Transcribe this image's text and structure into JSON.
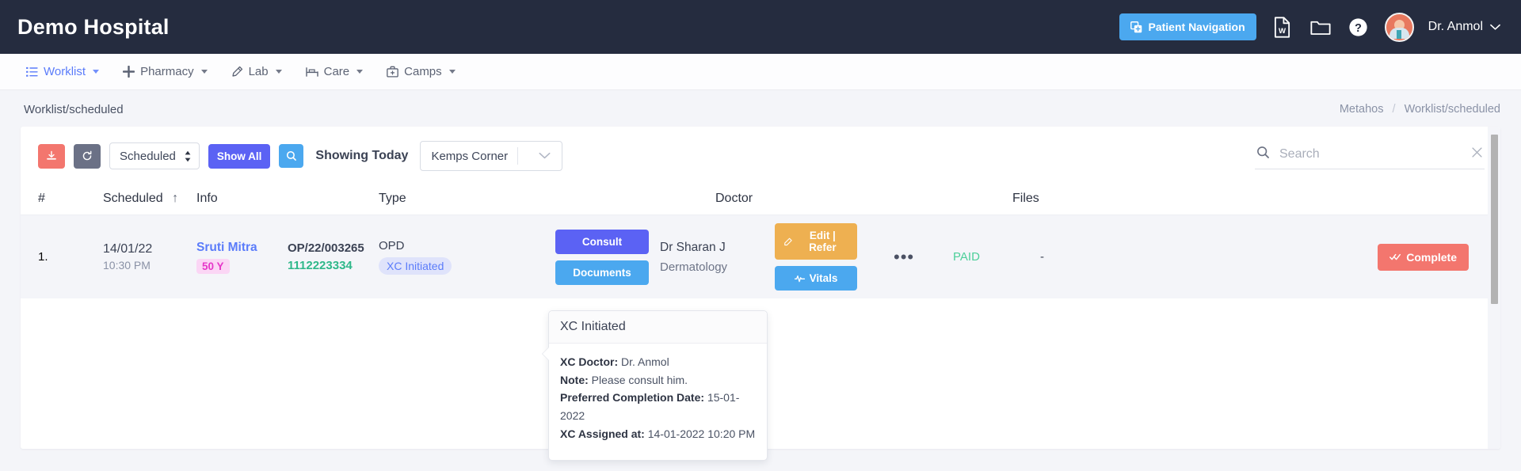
{
  "topbar": {
    "brand": "Demo Hospital",
    "patient_navigation_label": "Patient Navigation",
    "word_icon_name": "word-document-icon",
    "folder_icon_name": "folder-icon",
    "help_icon_name": "help-circle-icon",
    "username": "Dr. Anmol",
    "accent": "#4ba8ef",
    "background": "#252c3f"
  },
  "menubar": {
    "items": [
      {
        "label": "Worklist",
        "icon": "list-icon",
        "active": true
      },
      {
        "label": "Pharmacy",
        "icon": "plus-icon",
        "active": false
      },
      {
        "label": "Lab",
        "icon": "pipette-icon",
        "active": false
      },
      {
        "label": "Care",
        "icon": "bed-icon",
        "active": false
      },
      {
        "label": "Camps",
        "icon": "briefcase-medical-icon",
        "active": false
      }
    ]
  },
  "breadcrumb": {
    "page_title": "Worklist/scheduled",
    "root": "Metahos",
    "separator": "/",
    "current": "Worklist/scheduled"
  },
  "toolbar": {
    "download_icon": "download-icon",
    "refresh_icon": "refresh-icon",
    "status_select": "Scheduled",
    "show_all_label": "Show All",
    "search_button_icon": "search-icon",
    "showing_label": "Showing Today",
    "location_select": "Kemps Corner",
    "search_placeholder": "Search",
    "search_value": "",
    "clear_icon": "close-icon"
  },
  "table": {
    "columns": [
      "#",
      "Scheduled",
      "Info",
      "Type",
      "Doctor",
      "Files"
    ],
    "sort_indicator": "↑",
    "rows": [
      {
        "index": "1.",
        "scheduled_date": "14/01/22",
        "scheduled_time": "10:30 PM",
        "patient_name": "Sruti Mitra",
        "patient_age": "50 Y",
        "uid": "OP/22/003265",
        "phone": "1112223334",
        "visit_type": "OPD",
        "status_badge": "XC Initiated",
        "action_consult": "Consult",
        "action_documents": "Documents",
        "doctor_name": "Dr Sharan J",
        "doctor_speciality": "Dermatology",
        "action_edit_refer": "Edit | Refer",
        "action_vitals": "Vitals",
        "more_icon": "ellipsis-icon",
        "payment_status": "PAID",
        "files": "-",
        "action_complete": "Complete"
      }
    ]
  },
  "tooltip": {
    "title": "XC Initiated",
    "rows": [
      {
        "label": "XC Doctor:",
        "value": "Dr. Anmol"
      },
      {
        "label": "Note:",
        "value": "Please consult him."
      },
      {
        "label": "Preferred Completion Date:",
        "value": "15-01-2022"
      },
      {
        "label": "XC Assigned at:",
        "value": "14-01-2022 10:20 PM"
      }
    ]
  },
  "colors": {
    "primary_blue": "#4ba8ef",
    "indigo": "#5b62f4",
    "orange": "#eeb051",
    "red": "#f3766e",
    "green": "#4dcf9a",
    "pink": "#e637c9"
  }
}
